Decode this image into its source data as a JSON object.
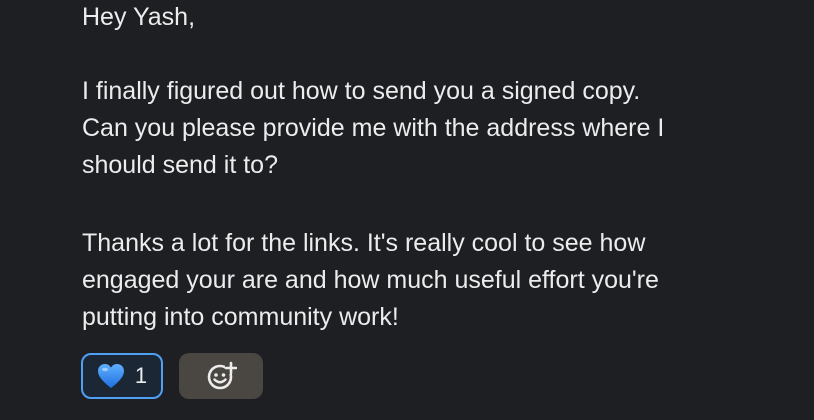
{
  "message": {
    "greeting": "Hey Yash,",
    "paragraph1": [
      "I finally figured out how to send you a signed copy.",
      "Can you please provide me with the address where I",
      "should send it to?"
    ],
    "paragraph2": [
      "Thanks a lot for the links. It's really cool to see how",
      "engaged your are and how much useful effort you're",
      "putting into community work!"
    ]
  },
  "reactions": [
    {
      "emoji": "blue-heart",
      "count": "1",
      "selected": true,
      "accent": "#4f9ff5"
    }
  ],
  "add_reaction": {
    "icon": "add-emoji-icon"
  },
  "colors": {
    "background": "#1d1f22",
    "text": "#ececed",
    "reaction_border": "#4f9ff5",
    "add_reaction_bg": "#4a4642"
  }
}
